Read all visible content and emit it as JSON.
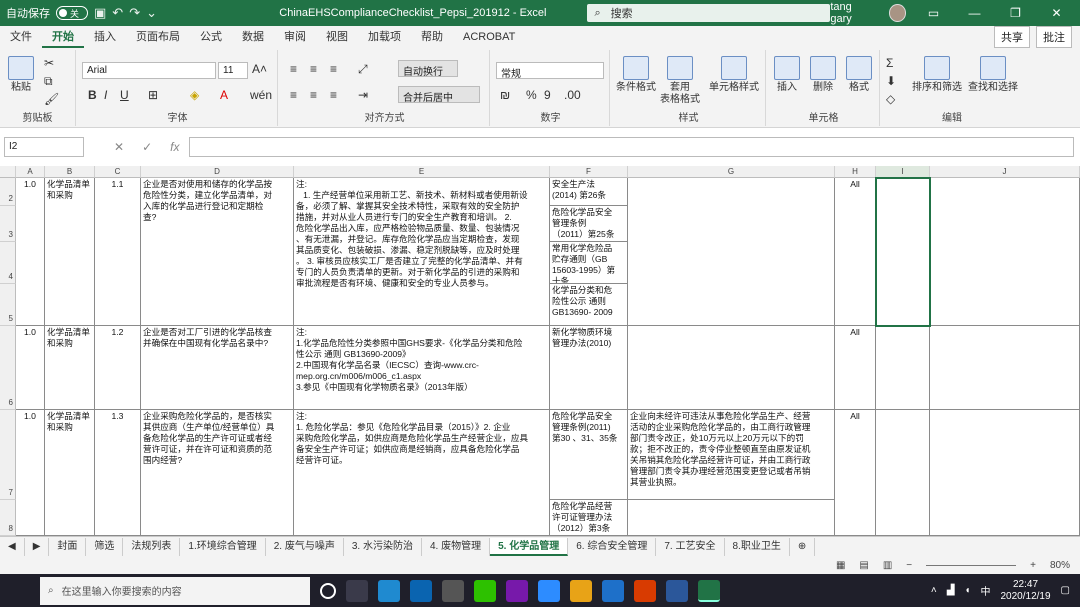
{
  "titlebar": {
    "autosave": "自动保存",
    "toggle": "关",
    "title": "ChinaEHSComplianceChecklist_Pepsi_201912  -  Excel",
    "search": "搜索",
    "user": "tang gary"
  },
  "tabs": [
    "文件",
    "开始",
    "插入",
    "页面布局",
    "公式",
    "数据",
    "审阅",
    "视图",
    "加载项",
    "帮助",
    "ACROBAT"
  ],
  "share_label": "共享",
  "comment_label": "批注",
  "ribbon": {
    "paste": "粘贴",
    "clipboard": "剪贴板",
    "font_name": "Arial",
    "font_size": "11",
    "font_group": "字体",
    "wrap": "自动换行",
    "merge": "合并后居中",
    "align_group": "对齐方式",
    "number_format": "常规",
    "number_group": "数字",
    "cond_format": "条件格式",
    "table_format": "套用\n表格格式",
    "cell_style": "单元格样式",
    "style_group": "样式",
    "insert": "插入",
    "delete": "删除",
    "format": "格式",
    "cells_group": "单元格",
    "sort": "排序和筛选",
    "find": "查找和选择",
    "edit_group": "编辑"
  },
  "namebox": "I2",
  "columns": [
    "A",
    "B",
    "C",
    "D",
    "E",
    "F",
    "G",
    "H",
    "I",
    "J"
  ],
  "rows": [
    "2",
    "3",
    "4",
    "5",
    "6",
    "7",
    "8"
  ],
  "cells": {
    "r1": {
      "a": "1.0",
      "b": "化学品清单\n和采购",
      "c": "1.1",
      "d": "企业是否对使用和储存的化学品按\n危险性分类，建立化学品清单，对\n入库的化学品进行登记和定期检\n查?",
      "e": "注:\n   1. 生产经营单位采用新工艺、新技术、新材料或者使用新设\n备，必须了解、掌握其安全技术特性，采取有效的安全防护\n措施，并对从业人员进行专门的安全生产教育和培训。 2.\n危险化学品出入库，应严格检验物品质量、数量、包装情况\n、有无泄漏，并登记。库存危险化学品应当定期检查，发现\n其品质变化、包装破损、渗漏、稳定剂脱缺等，应及时处理\n。 3. 审核员应核实工厂是否建立了完整的化学品清单、并有\n专门的人员负责清单的更新。对于新化学品的引进的采购和\n审批流程是否有环境、健康和安全的专业人员参与。",
      "f1": "安全生产法\n(2014) 第26条",
      "f2": "危险化学品安全\n管理条例\n（2011）第25条",
      "f3": "常用化学危险品\n贮存通则（GB\n15603-1995）第\n十条",
      "f4": "化学品分类和危\n险性公示 通则\nGB13690- 2009",
      "h": "All"
    },
    "r2": {
      "a": "1.0",
      "b": "化学品清单\n和采购",
      "c": "1.2",
      "d": "企业是否对工厂引进的化学品核查\n并确保在中国现有化学品名录中?",
      "e": "注:\n1.化学品危险性分类参照中国GHS要求-《化学品分类和危险\n性公示 通则 GB13690-2009》\n2.中国现有化学品名录（IECSC）查询-www.crc-\nmep.org.cn/m006/m006_c1.aspx\n3.参见《中国现有化学物质名录》（2013年版）",
      "f": "新化学物质环境\n管理办法(2010)",
      "h": "All"
    },
    "r3": {
      "a": "1.0",
      "b": "化学品清单\n和采购",
      "c": "1.3",
      "d": "企业采购危险化学品的，是否核实\n其供应商（生产单位/经营单位）具\n备危险化学品的生产许可证或者经\n营许可证，并在许可证和资质的范\n围内经营?",
      "e": "注:\n1. 危险化学品：参见《危险化学品目录（2015）》2. 企业\n采购危险化学品，如供应商是危险化学品生产经营企业，应具\n备安全生产许可证；如供应商是经销商，应具备危险化学品\n经营许可证。",
      "f1": "危险化学品安全\n管理条例(2011)\n第30 、31、35条",
      "f2": "危险化学品经营\n许可证管理办法\n（2012）第3条",
      "g": "企业向未经许可违法从事危险化学品生产、经营\n活动的企业采购危险化学品的，由工商行政管理\n部门责令改正，处10万元以上20万元以下的罚\n款；拒不改正的，责令停业整顿直至由原发证机\n关吊销其危险化学品经营许可证，并由工商行政\n管理部门责令其办理经营范围变更登记或者吊销\n其营业执照。",
      "h": "All"
    }
  },
  "sheet_tabs": [
    "封面",
    "筛选",
    "法规列表",
    "1.环境综合管理",
    "2. 废气与噪声",
    "3. 水污染防治",
    "4. 废物管理",
    "5. 化学品管理",
    "6. 综合安全管理",
    "7. 工艺安全",
    "8.职业卫生"
  ],
  "active_sheet": "5. 化学品管理",
  "zoom": "80%",
  "taskbar": {
    "search": "在这里输入你要搜索的内容",
    "time": "22:47",
    "date": "2020/12/19",
    "ime": "中"
  }
}
